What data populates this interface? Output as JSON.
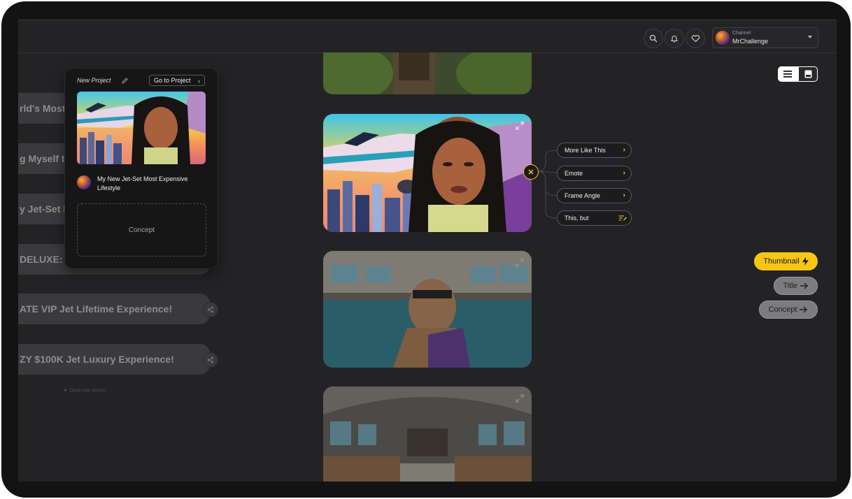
{
  "header": {
    "channel_label": "Channel",
    "channel_name": "MrChallenge"
  },
  "list": {
    "items": [
      {
        "label": "rld's Most"
      },
      {
        "label": "g Myself to"
      },
      {
        "label": "y Jet-Set M"
      },
      {
        "label": "DELUXE: I"
      },
      {
        "label": "ATE VIP Jet Lifetime Experience!"
      },
      {
        "label": "ZY $100K Jet Luxury Experience!"
      }
    ],
    "give_more": "Give me more!"
  },
  "card": {
    "title": "New Project",
    "go_button": "Go to Project",
    "video_title": "My New Jet-Set Most Expensive Lifestyle",
    "concept_placeholder": "Concept"
  },
  "options": {
    "items": [
      {
        "label": "More Like This",
        "icon": "chevron-right"
      },
      {
        "label": "Emote",
        "icon": "chevron-right"
      },
      {
        "label": "Frame Angle",
        "icon": "chevron-right"
      },
      {
        "label": "This, but",
        "icon": "text-edit"
      }
    ]
  },
  "view_toggle": {
    "active": "list",
    "options": [
      "list-icon",
      "card-icon"
    ]
  },
  "pills": {
    "thumbnail": "Thumbnail",
    "title": "Title",
    "concept": "Concept"
  },
  "colors": {
    "accent": "#f7c514",
    "background": "#232325",
    "card": "#161617"
  }
}
